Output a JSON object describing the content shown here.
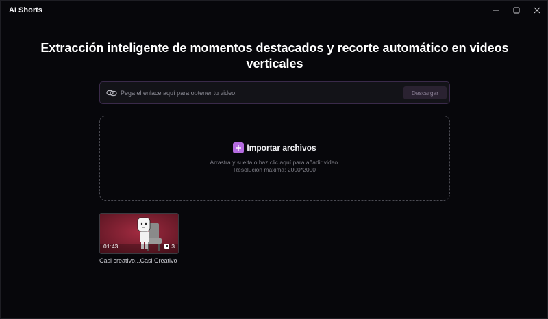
{
  "window": {
    "title": "AI Shorts",
    "controls": [
      "minimize-icon",
      "maximize-icon",
      "close-icon"
    ]
  },
  "main": {
    "headline": "Extracción inteligente de momentos destacados y recorte automático en videos verticales"
  },
  "url_bar": {
    "icon": "link-icon",
    "placeholder": "Pega el enlace aquí para obtener tu video.",
    "value": "",
    "download_label": "Descargar"
  },
  "dropzone": {
    "icon": "plus-icon",
    "import_label": "Importar archivos",
    "hint_line1": "Arrastra y suelta o haz clic aquí para añadir video.",
    "hint_line2": "Resolución máxima: 2000*2000"
  },
  "videos": [
    {
      "duration": "01:43",
      "clip_count": "3",
      "title": "Casi creativo...Casi Creativo"
    }
  ],
  "colors": {
    "background": "#07070b",
    "accent": "#b56be0",
    "thumbnail_bg": "#7a1f2e"
  }
}
